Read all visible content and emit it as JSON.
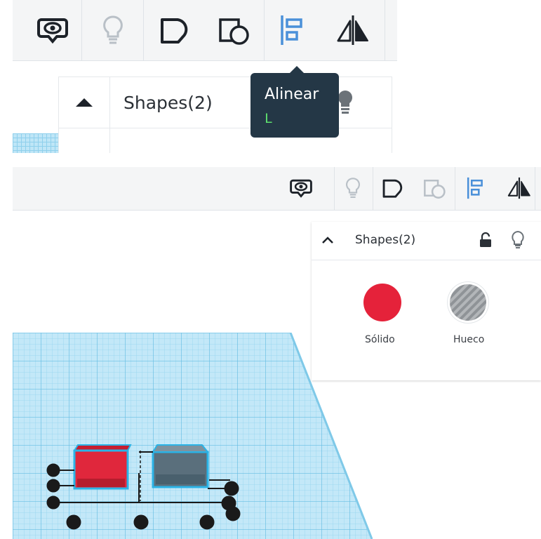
{
  "top_panel": {
    "toolbar": {
      "icons": [
        "notes-icon",
        "bulb-icon",
        "group-icon",
        "ungroup-icon",
        "align-icon",
        "mirror-icon"
      ]
    },
    "inspector": {
      "title": "Shapes(2)"
    },
    "tooltip": {
      "label": "Alinear",
      "shortcut": "L"
    }
  },
  "bottom_panel": {
    "toolbar": {
      "icons": [
        "notes-icon",
        "bulb-icon",
        "group-icon",
        "ungroup-icon",
        "align-icon",
        "mirror-icon"
      ]
    },
    "inspector": {
      "title": "Shapes(2)",
      "solid_label": "Sólido",
      "hole_label": "Hueco"
    }
  },
  "colors": {
    "toolbar_bg": "#f4f5f6",
    "accent_blue": "#4a90d9",
    "solid_red": "#e5223a",
    "tooltip_bg": "#243746",
    "tooltip_shortcut": "#5ee06e",
    "grid_blue": "#bfe6f7"
  }
}
